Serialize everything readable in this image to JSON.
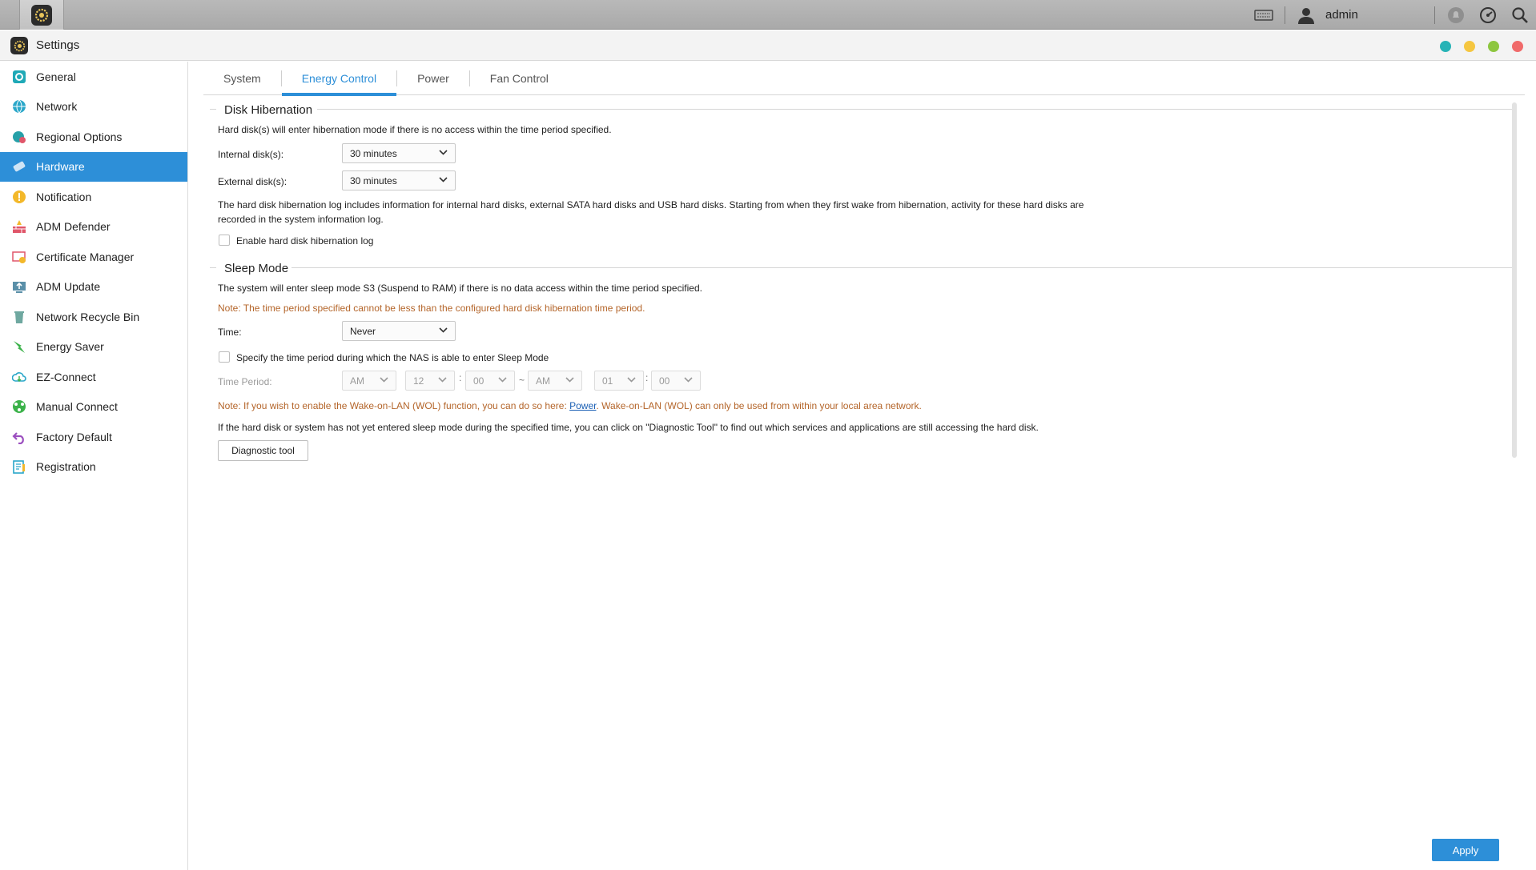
{
  "taskbar": {
    "user": "admin"
  },
  "window": {
    "title": "Settings"
  },
  "colors": {
    "accent": "#2d8fd8",
    "note": "#b4652a",
    "dot_teal": "#27b3b6",
    "dot_yellow": "#f5c640",
    "dot_green": "#8dc63f",
    "dot_red": "#f06a6a"
  },
  "sidebar": {
    "items": [
      {
        "label": "General",
        "icon": "general-icon"
      },
      {
        "label": "Network",
        "icon": "globe-icon"
      },
      {
        "label": "Regional Options",
        "icon": "regional-icon"
      },
      {
        "label": "Hardware",
        "icon": "hardware-icon"
      },
      {
        "label": "Notification",
        "icon": "notification-icon"
      },
      {
        "label": "ADM Defender",
        "icon": "firewall-icon"
      },
      {
        "label": "Certificate Manager",
        "icon": "certificate-icon"
      },
      {
        "label": "ADM Update",
        "icon": "update-icon"
      },
      {
        "label": "Network Recycle Bin",
        "icon": "recycle-bin-icon"
      },
      {
        "label": "Energy Saver",
        "icon": "energy-icon"
      },
      {
        "label": "EZ-Connect",
        "icon": "cloud-icon"
      },
      {
        "label": "Manual Connect",
        "icon": "manual-connect-icon"
      },
      {
        "label": "Factory Default",
        "icon": "undo-icon"
      },
      {
        "label": "Registration",
        "icon": "registration-icon"
      }
    ],
    "active": "Hardware"
  },
  "tabs": [
    "System",
    "Energy Control",
    "Power",
    "Fan Control"
  ],
  "disk": {
    "title": "Disk Hibernation",
    "desc": "Hard disk(s) will enter hibernation mode if there is no access within the time period specified.",
    "internal_label": "Internal disk(s):",
    "internal_value": "30 minutes",
    "external_label": "External disk(s):",
    "external_value": "30 minutes",
    "log_desc_1": "The hard disk hibernation log includes information for internal hard disks, external SATA hard disks and USB hard disks. Starting from when they first wake from hibernation, activity for these hard disks are",
    "log_desc_2": "recorded in the system information log.",
    "log_checkbox": "Enable hard disk hibernation log"
  },
  "sleep": {
    "title": "Sleep Mode",
    "desc": "The system will enter sleep mode S3 (Suspend to RAM) if there is no data access within the time period specified.",
    "note": "Note: The time period specified cannot be less than the configured hard disk hibernation time period.",
    "time_label": "Time:",
    "time_value": "Never",
    "period_checkbox": "Specify the time period during which the NAS is able to enter Sleep Mode",
    "period_label": "Time Period:",
    "from_ampm": "AM",
    "from_hour": "12",
    "from_min": "00",
    "tilde": "~",
    "to_ampm": "AM",
    "to_hour": "01",
    "to_min": "00",
    "colon": ":",
    "wol_note_pre": "Note: If you wish to enable the Wake-on-LAN (WOL) function, you can do so here: ",
    "wol_link": "Power",
    "wol_note_post": ". Wake-on-LAN (WOL) can only be used from within your local area network.",
    "diag_desc": "If the hard disk or system has not yet entered sleep mode during the specified time, you can click on \"Diagnostic Tool\" to find out which services and applications are still accessing the hard disk.",
    "diag_button": "Diagnostic tool"
  },
  "apply_button": "Apply"
}
